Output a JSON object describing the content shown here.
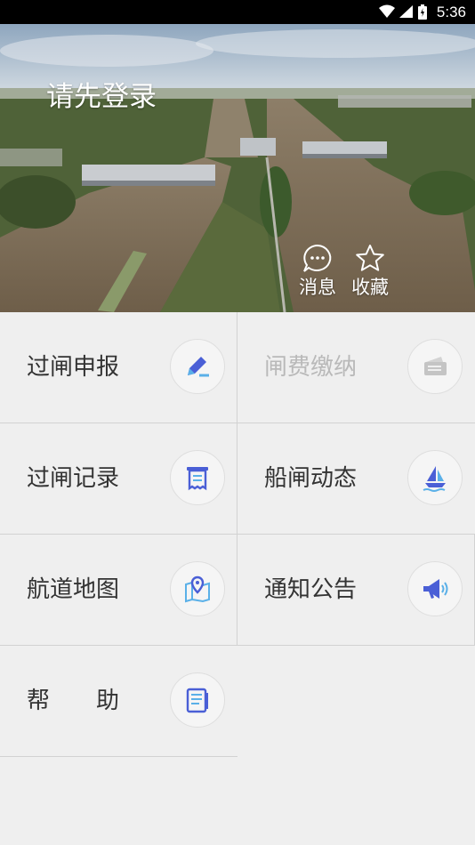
{
  "status_bar": {
    "time": "5:36"
  },
  "banner": {
    "login_text": "请先登录",
    "messages_label": "消息",
    "favorites_label": "收藏"
  },
  "menu": [
    {
      "id": "lock-declare",
      "label": "过闸申报",
      "icon": "pen-edit-icon",
      "enabled": true
    },
    {
      "id": "lock-fee",
      "label": "闸费缴纳",
      "icon": "wallet-icon",
      "enabled": false
    },
    {
      "id": "lock-records",
      "label": "过闸记录",
      "icon": "receipt-icon",
      "enabled": true
    },
    {
      "id": "lock-status",
      "label": "船闸动态",
      "icon": "sailboat-icon",
      "enabled": true
    },
    {
      "id": "waterway-map",
      "label": "航道地图",
      "icon": "map-pin-icon",
      "enabled": true
    },
    {
      "id": "notices",
      "label": "通知公告",
      "icon": "megaphone-icon",
      "enabled": true
    },
    {
      "id": "help",
      "label": "帮　　助",
      "icon": "document-icon",
      "enabled": true
    }
  ],
  "colors": {
    "accent": "#4a5fd6",
    "accent_light": "#5ab0e8",
    "disabled": "#c4c4c4"
  }
}
